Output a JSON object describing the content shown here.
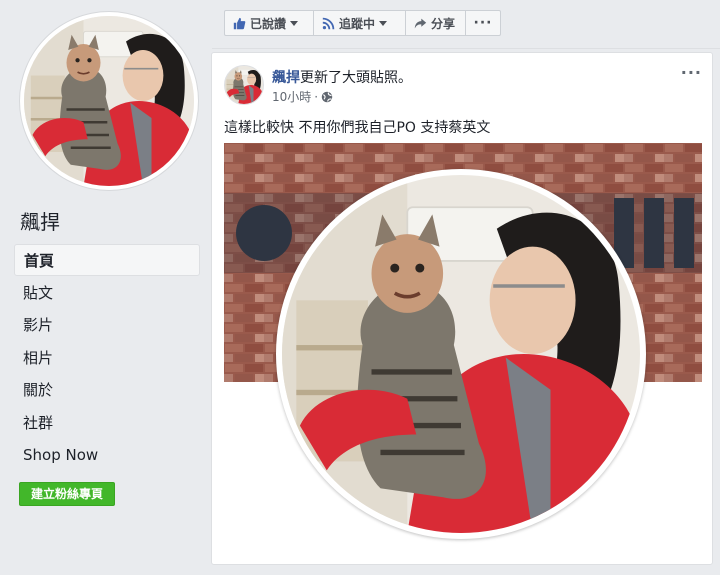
{
  "page": {
    "name": "飆捍"
  },
  "sidebar": {
    "items": [
      {
        "label": "首頁",
        "active": true
      },
      {
        "label": "貼文"
      },
      {
        "label": "影片"
      },
      {
        "label": "相片"
      },
      {
        "label": "關於"
      },
      {
        "label": "社群"
      },
      {
        "label": "Shop Now"
      }
    ],
    "cta_label": "建立粉絲專頁"
  },
  "actions": {
    "like_label": "已說讚",
    "follow_label": "追蹤中",
    "share_label": "分享",
    "more_label": "···"
  },
  "post": {
    "author": "飆捍",
    "action_text": "更新了大頭貼照。",
    "time": "10小時",
    "meta_separator": "·",
    "text": "這樣比較快 不用你們我自己PO 支持蔡英文",
    "more_label": "···"
  },
  "colors": {
    "link": "#385898",
    "cta": "#42b72a",
    "background": "#e9ebee",
    "jacket": "#d92b36"
  }
}
